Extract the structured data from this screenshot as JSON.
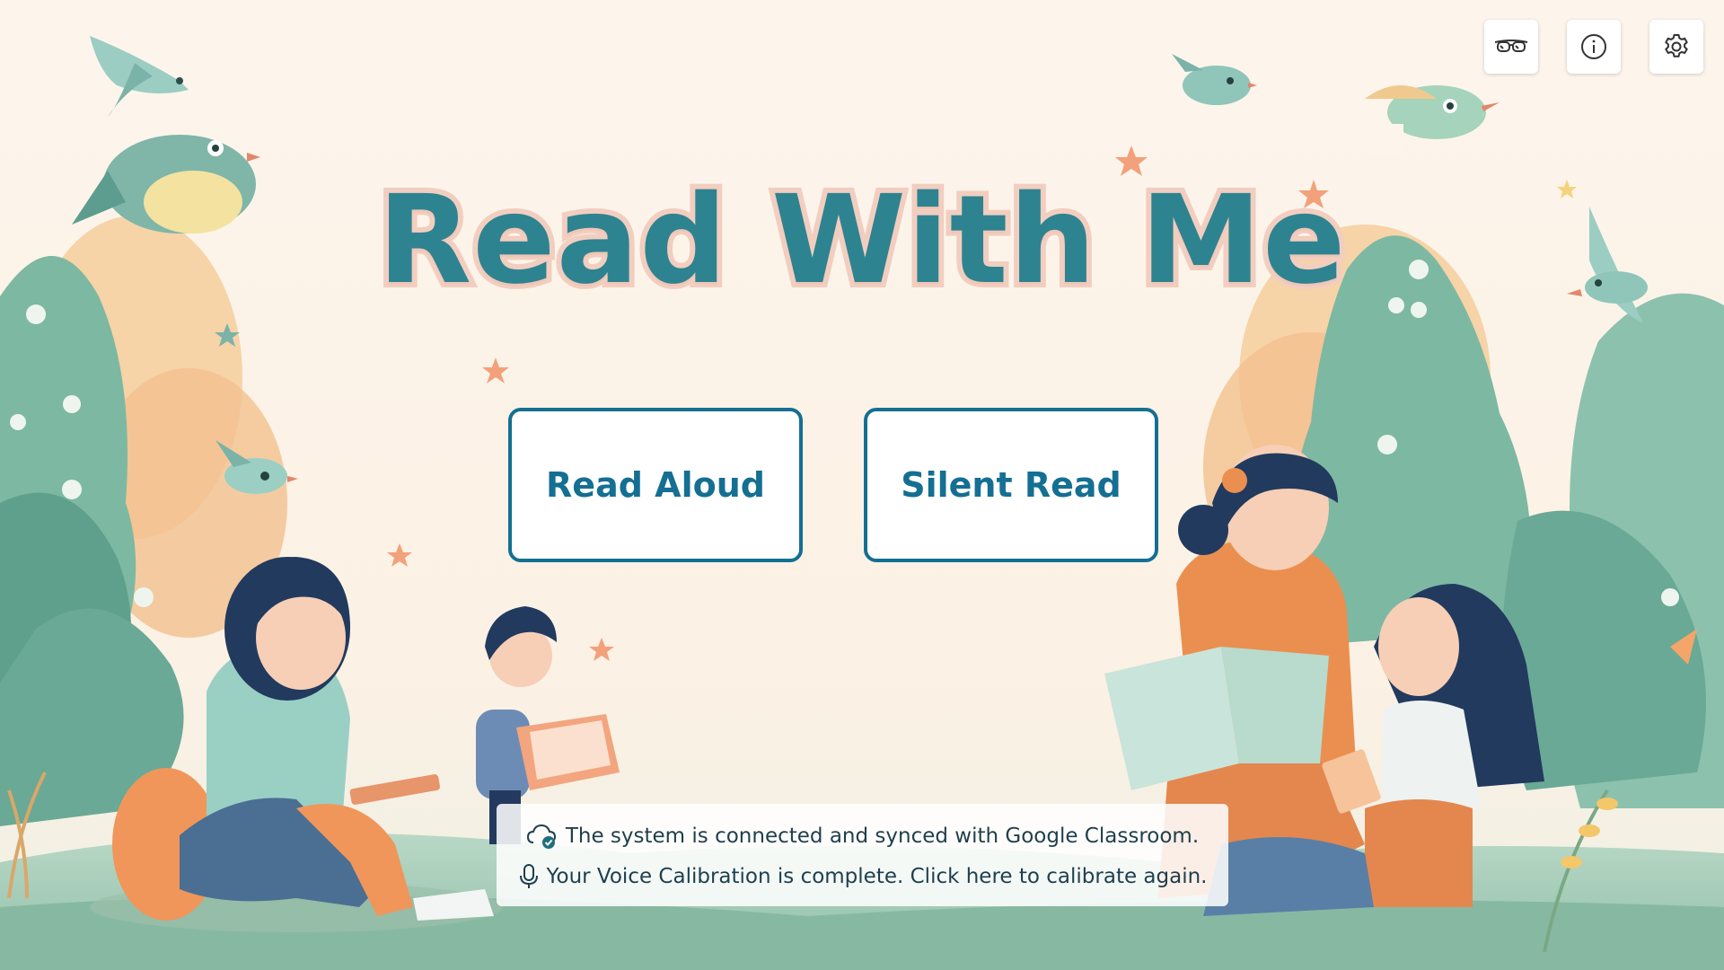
{
  "app": {
    "title": "Read With Me",
    "palette": {
      "title_fill": "#2e8390",
      "title_outline": "#f2cec0",
      "button_accent": "#146f93",
      "background": "#fcf3e9"
    }
  },
  "toolbar": {
    "buttons": [
      {
        "name": "glasses-button",
        "icon": "glasses-icon"
      },
      {
        "name": "info-button",
        "icon": "info-icon"
      },
      {
        "name": "settings-button",
        "icon": "gear-icon"
      }
    ]
  },
  "modes": {
    "read_aloud_label": "Read Aloud",
    "silent_read_label": "Silent Read"
  },
  "status": {
    "sync_message": "The system is connected and synced with Google Classroom.",
    "sync_icon": "cloud-check-icon",
    "calibration_message": "Your Voice Calibration is complete. Click here to calibrate again.",
    "calibration_icon": "microphone-icon"
  },
  "illustration": {
    "description_icon": "reading-children-illustration"
  }
}
